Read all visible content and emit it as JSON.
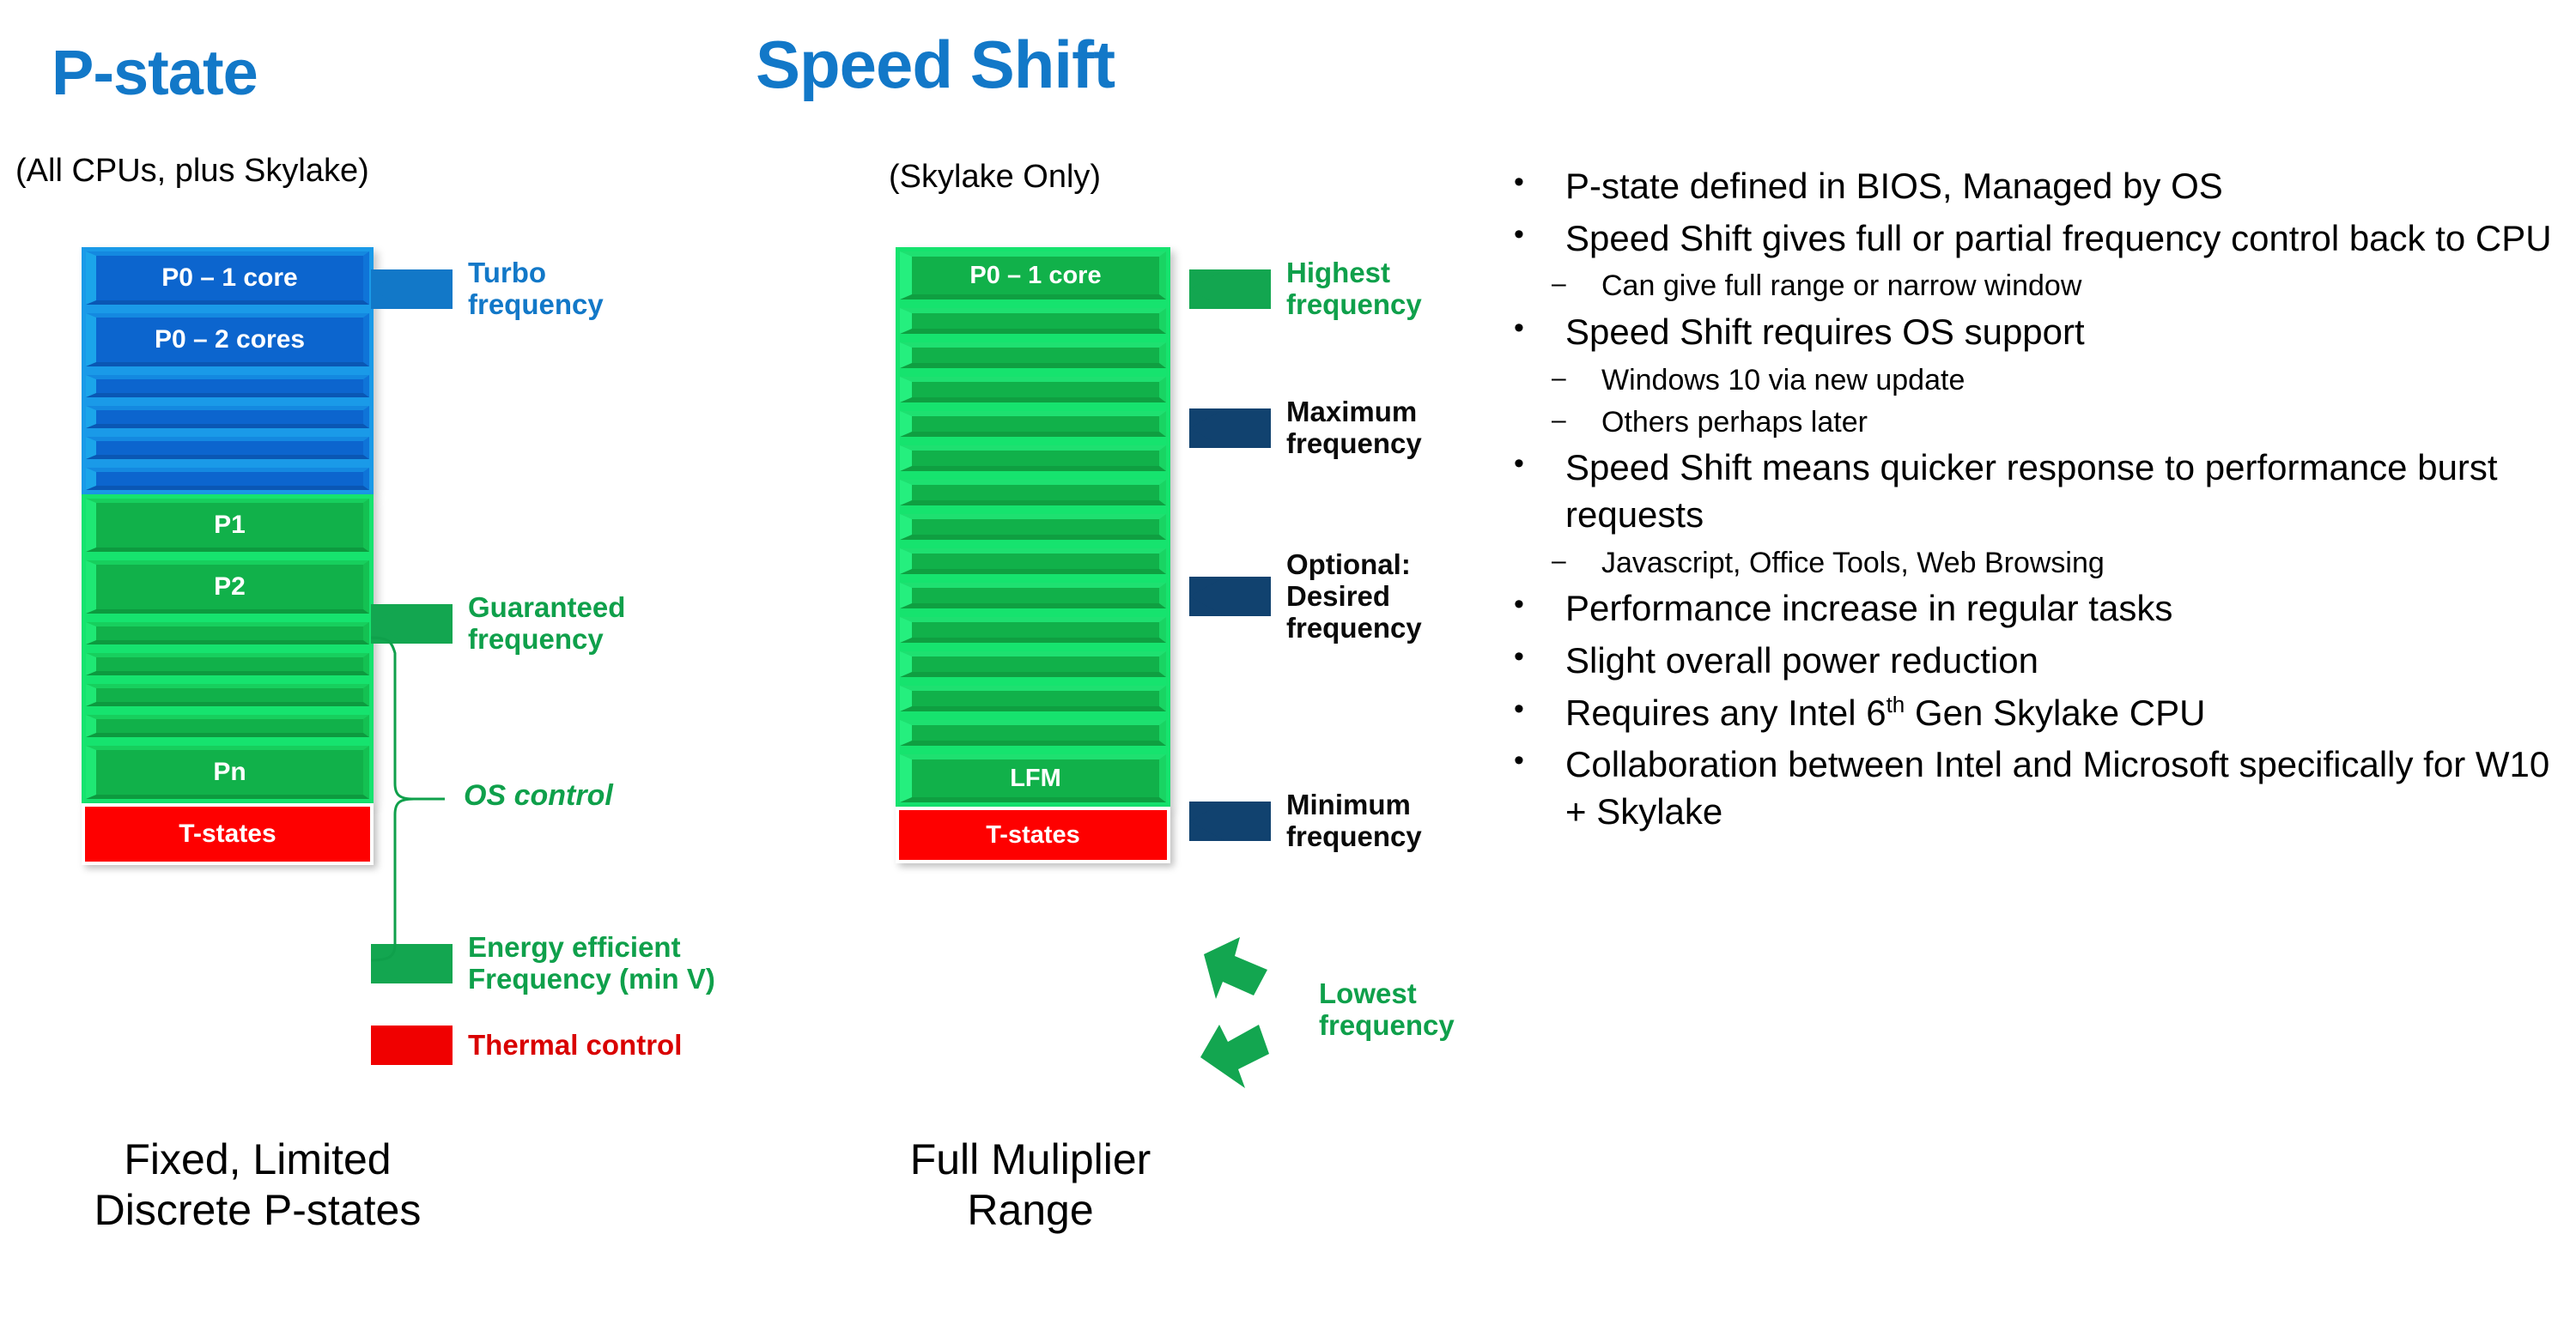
{
  "columns": {
    "pstate": {
      "title": "P-state",
      "subtitle": "(All CPUs, plus Skylake)",
      "caption": "Fixed, Limited\nDiscrete P-states",
      "bars": [
        {
          "label": "P0 – 1 core",
          "kind": "blue",
          "tall": true
        },
        {
          "label": "P0 – 2 cores",
          "kind": "blue",
          "tall": true
        },
        {
          "label": "",
          "kind": "blue",
          "tall": false
        },
        {
          "label": "",
          "kind": "blue",
          "tall": false
        },
        {
          "label": "",
          "kind": "blue",
          "tall": false
        },
        {
          "label": "",
          "kind": "blue",
          "tall": false
        },
        {
          "label": "P1",
          "kind": "green",
          "tall": true
        },
        {
          "label": "P2",
          "kind": "green",
          "tall": true
        },
        {
          "label": "",
          "kind": "green",
          "tall": false
        },
        {
          "label": "",
          "kind": "green",
          "tall": false
        },
        {
          "label": "",
          "kind": "green",
          "tall": false
        },
        {
          "label": "",
          "kind": "green",
          "tall": false
        },
        {
          "label": "Pn",
          "kind": "green",
          "tall": true
        },
        {
          "label": "T-states",
          "kind": "red",
          "tall": true
        }
      ],
      "annotations": [
        {
          "name": "turbo-frequency",
          "text": "Turbo\nfrequency",
          "color": "blue"
        },
        {
          "name": "guaranteed-frequency",
          "text": "Guaranteed\nfrequency",
          "color": "green"
        },
        {
          "name": "energy-efficient-frequency",
          "text": "Energy efficient\nFrequency (min V)",
          "color": "green"
        },
        {
          "name": "thermal-control",
          "text": "Thermal control",
          "color": "red"
        }
      ],
      "bracket_label": "OS control"
    },
    "speedshift": {
      "title": "Speed Shift",
      "subtitle": "(Skylake Only)",
      "caption": "Full Muliplier\nRange",
      "bars": [
        {
          "label": "P0 – 1 core",
          "kind": "green",
          "tall": true
        },
        {
          "label": "",
          "kind": "green",
          "tall": false
        },
        {
          "label": "",
          "kind": "green",
          "tall": false
        },
        {
          "label": "",
          "kind": "green",
          "tall": false
        },
        {
          "label": "",
          "kind": "green",
          "tall": false
        },
        {
          "label": "",
          "kind": "green",
          "tall": false
        },
        {
          "label": "",
          "kind": "green",
          "tall": false
        },
        {
          "label": "",
          "kind": "green",
          "tall": false
        },
        {
          "label": "",
          "kind": "green",
          "tall": false
        },
        {
          "label": "",
          "kind": "green",
          "tall": false
        },
        {
          "label": "",
          "kind": "green",
          "tall": false
        },
        {
          "label": "",
          "kind": "green",
          "tall": false
        },
        {
          "label": "",
          "kind": "green",
          "tall": false
        },
        {
          "label": "",
          "kind": "green",
          "tall": false
        },
        {
          "label": "LFM",
          "kind": "green",
          "tall": true
        },
        {
          "label": "T-states",
          "kind": "red",
          "tall": true
        }
      ],
      "annotations": [
        {
          "name": "highest-frequency",
          "text": "Highest\nfrequency",
          "color": "green"
        },
        {
          "name": "maximum-frequency",
          "text": "Maximum\nfrequency",
          "color": "black"
        },
        {
          "name": "optional-desired-frequency",
          "text": "Optional:\nDesired\nfrequency",
          "color": "black"
        },
        {
          "name": "minimum-frequency",
          "text": "Minimum\nfrequency",
          "color": "black"
        },
        {
          "name": "lowest-frequency",
          "text": "Lowest\nfrequency",
          "color": "green"
        }
      ]
    }
  },
  "bullets": [
    {
      "level": 1,
      "text": "P-state defined in BIOS, Managed by OS"
    },
    {
      "level": 1,
      "text": "Speed Shift gives full or partial frequency control back to CPU"
    },
    {
      "level": 2,
      "text": "Can give full range or narrow window"
    },
    {
      "level": 1,
      "text": "Speed Shift requires OS support"
    },
    {
      "level": 2,
      "text": "Windows 10 via new update"
    },
    {
      "level": 2,
      "text": "Others perhaps later"
    },
    {
      "level": 1,
      "text": "Speed Shift means quicker response to performance burst requests"
    },
    {
      "level": 2,
      "text": "Javascript, Office Tools, Web Browsing"
    },
    {
      "level": 1,
      "text": "Performance increase in regular tasks"
    },
    {
      "level": 1,
      "text": "Slight overall power reduction"
    },
    {
      "level": 1,
      "text": "Requires any Intel 6th Gen Skylake CPU",
      "html": "Requires any Intel 6<sup>th</sup> Gen Skylake CPU"
    },
    {
      "level": 1,
      "text": "Collaboration between Intel and Microsoft specifically for W10 + Skylake"
    }
  ],
  "bullet_marks": {
    "level1": "•",
    "level2": "–"
  },
  "colors": {
    "title_blue": "#1278c8",
    "bar_blue": "#0c65ce",
    "bar_green": "#11b14a",
    "bar_red": "#fe0000",
    "arrow_navy": "#11426f",
    "arrow_green": "#13a650",
    "label_red": "#d90000"
  }
}
